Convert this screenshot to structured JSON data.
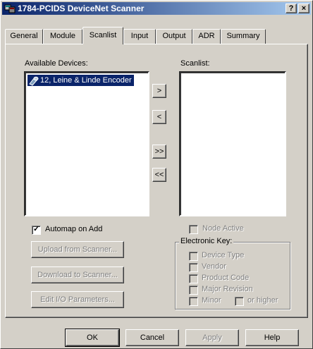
{
  "window": {
    "title": "1784-PCIDS DeviceNet Scanner",
    "help_button": "?",
    "close_button": "×"
  },
  "tabs": [
    {
      "label": "General"
    },
    {
      "label": "Module"
    },
    {
      "label": "Scanlist",
      "active": true
    },
    {
      "label": "Input"
    },
    {
      "label": "Output"
    },
    {
      "label": "ADR"
    },
    {
      "label": "Summary"
    }
  ],
  "available_devices": {
    "label": "Available Devices:",
    "items": [
      "12, Leine & Linde Encoder"
    ]
  },
  "scanlist": {
    "label": "Scanlist:",
    "items": []
  },
  "transfer_buttons": {
    "add_one": ">",
    "remove_one": "<",
    "add_all": ">>",
    "remove_all": "<<"
  },
  "automap": {
    "label": "Automap on Add",
    "checked": true
  },
  "left_buttons": {
    "upload": "Upload from Scanner...",
    "download": "Download to Scanner...",
    "edit_io": "Edit I/O Parameters..."
  },
  "node_active": {
    "label": "Node Active",
    "checked": false,
    "enabled": false
  },
  "electronic_key": {
    "title": "Electronic Key:",
    "device_type": "Device Type",
    "vendor": "Vendor",
    "product_code": "Product Code",
    "major_revision": "Major Revision",
    "minor": "Minor",
    "or_higher": "or higher"
  },
  "footer": {
    "ok": "OK",
    "cancel": "Cancel",
    "apply": "Apply",
    "help": "Help"
  }
}
